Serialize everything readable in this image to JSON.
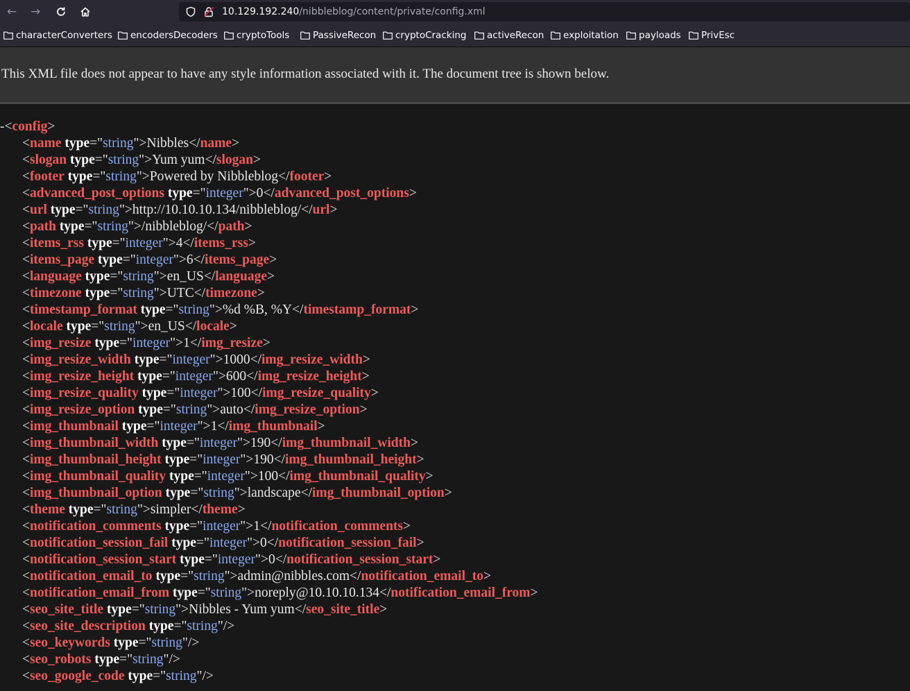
{
  "browser": {
    "url_host": "10.129.192.240",
    "url_path": "/nibbleblog/content/private/config.xml"
  },
  "bookmarks": [
    {
      "label": "characterConverters"
    },
    {
      "label": "encodersDecoders"
    },
    {
      "label": "cryptoTools"
    },
    {
      "label": "PassiveRecon"
    },
    {
      "label": "cryptoCracking"
    },
    {
      "label": "activeRecon"
    },
    {
      "label": "exploitation"
    },
    {
      "label": "payloads"
    },
    {
      "label": "PrivEsc"
    }
  ],
  "notice": "This XML file does not appear to have any style information associated with it. The document tree is shown below.",
  "xml": {
    "root_tag": "config",
    "children": [
      {
        "tag": "name",
        "attr": "type",
        "attr_value": "string",
        "text": "Nibbles"
      },
      {
        "tag": "slogan",
        "attr": "type",
        "attr_value": "string",
        "text": "Yum yum"
      },
      {
        "tag": "footer",
        "attr": "type",
        "attr_value": "string",
        "text": "Powered by Nibbleblog"
      },
      {
        "tag": "advanced_post_options",
        "attr": "type",
        "attr_value": "integer",
        "text": "0"
      },
      {
        "tag": "url",
        "attr": "type",
        "attr_value": "string",
        "text": "http://10.10.10.134/nibbleblog/"
      },
      {
        "tag": "path",
        "attr": "type",
        "attr_value": "string",
        "text": "/nibbleblog/"
      },
      {
        "tag": "items_rss",
        "attr": "type",
        "attr_value": "integer",
        "text": "4"
      },
      {
        "tag": "items_page",
        "attr": "type",
        "attr_value": "integer",
        "text": "6"
      },
      {
        "tag": "language",
        "attr": "type",
        "attr_value": "string",
        "text": "en_US"
      },
      {
        "tag": "timezone",
        "attr": "type",
        "attr_value": "string",
        "text": "UTC"
      },
      {
        "tag": "timestamp_format",
        "attr": "type",
        "attr_value": "string",
        "text": "%d %B, %Y"
      },
      {
        "tag": "locale",
        "attr": "type",
        "attr_value": "string",
        "text": "en_US"
      },
      {
        "tag": "img_resize",
        "attr": "type",
        "attr_value": "integer",
        "text": "1"
      },
      {
        "tag": "img_resize_width",
        "attr": "type",
        "attr_value": "integer",
        "text": "1000"
      },
      {
        "tag": "img_resize_height",
        "attr": "type",
        "attr_value": "integer",
        "text": "600"
      },
      {
        "tag": "img_resize_quality",
        "attr": "type",
        "attr_value": "integer",
        "text": "100"
      },
      {
        "tag": "img_resize_option",
        "attr": "type",
        "attr_value": "string",
        "text": "auto"
      },
      {
        "tag": "img_thumbnail",
        "attr": "type",
        "attr_value": "integer",
        "text": "1"
      },
      {
        "tag": "img_thumbnail_width",
        "attr": "type",
        "attr_value": "integer",
        "text": "190"
      },
      {
        "tag": "img_thumbnail_height",
        "attr": "type",
        "attr_value": "integer",
        "text": "190"
      },
      {
        "tag": "img_thumbnail_quality",
        "attr": "type",
        "attr_value": "integer",
        "text": "100"
      },
      {
        "tag": "img_thumbnail_option",
        "attr": "type",
        "attr_value": "string",
        "text": "landscape"
      },
      {
        "tag": "theme",
        "attr": "type",
        "attr_value": "string",
        "text": "simpler"
      },
      {
        "tag": "notification_comments",
        "attr": "type",
        "attr_value": "integer",
        "text": "1"
      },
      {
        "tag": "notification_session_fail",
        "attr": "type",
        "attr_value": "integer",
        "text": "0"
      },
      {
        "tag": "notification_session_start",
        "attr": "type",
        "attr_value": "integer",
        "text": "0"
      },
      {
        "tag": "notification_email_to",
        "attr": "type",
        "attr_value": "string",
        "text": "admin@nibbles.com"
      },
      {
        "tag": "notification_email_from",
        "attr": "type",
        "attr_value": "string",
        "text": "noreply@10.10.10.134"
      },
      {
        "tag": "seo_site_title",
        "attr": "type",
        "attr_value": "string",
        "text": "Nibbles - Yum yum"
      },
      {
        "tag": "seo_site_description",
        "attr": "type",
        "attr_value": "string",
        "self_closing": true
      },
      {
        "tag": "seo_keywords",
        "attr": "type",
        "attr_value": "string",
        "self_closing": true
      },
      {
        "tag": "seo_robots",
        "attr": "type",
        "attr_value": "string",
        "self_closing": true
      },
      {
        "tag": "seo_google_code",
        "attr": "type",
        "attr_value": "string",
        "self_closing": true
      }
    ]
  },
  "colors": {
    "tag": "#ef5a5a",
    "attr_value": "#8aa8f0",
    "background": "#181818",
    "notice_background": "#333333"
  }
}
